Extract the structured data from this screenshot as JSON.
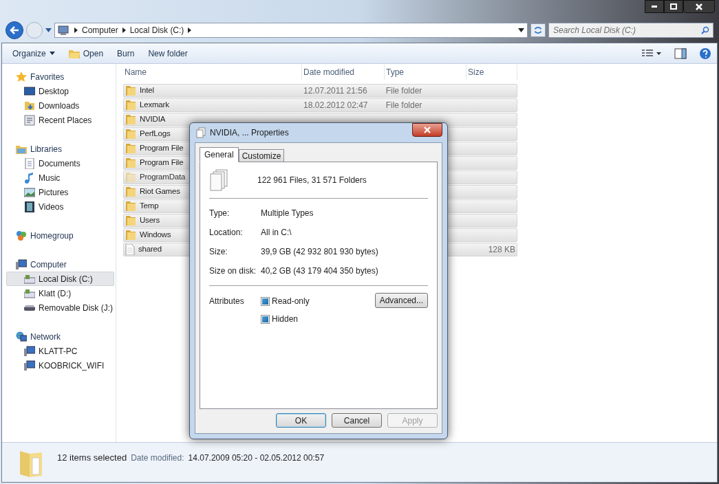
{
  "address_bar": {
    "crumbs": [
      "Computer",
      "Local Disk (C:)"
    ],
    "search_placeholder": "Search Local Disk (C:)"
  },
  "toolbar": {
    "items": [
      {
        "label": "Organize",
        "kind": "menu"
      },
      {
        "label": "Open",
        "kind": "icon"
      },
      {
        "label": "Burn",
        "kind": "plain"
      },
      {
        "label": "New folder",
        "kind": "plain"
      }
    ]
  },
  "sidebar": {
    "groups": [
      {
        "label": "Favorites",
        "kind": "star",
        "items": [
          {
            "label": "Desktop",
            "kind": "desktop",
            "selected": false
          },
          {
            "label": "Downloads",
            "kind": "download",
            "selected": false
          },
          {
            "label": "Recent Places",
            "kind": "recent",
            "selected": false
          }
        ]
      },
      {
        "label": "Libraries",
        "kind": "library",
        "items": [
          {
            "label": "Documents",
            "kind": "document",
            "selected": false
          },
          {
            "label": "Music",
            "kind": "music",
            "selected": false
          },
          {
            "label": "Pictures",
            "kind": "picture",
            "selected": false
          },
          {
            "label": "Videos",
            "kind": "video",
            "selected": false
          }
        ]
      },
      {
        "label": "Homegroup",
        "kind": "homegroup"
      },
      {
        "label": "Computer",
        "kind": "computer",
        "items": [
          {
            "label": "Local Disk (C:)",
            "kind": "disk",
            "selected": true
          },
          {
            "label": "Klatt (D:)",
            "kind": "disk",
            "selected": false
          },
          {
            "label": "Removable Disk (J:)",
            "kind": "removable",
            "selected": false
          }
        ]
      },
      {
        "label": "Network",
        "kind": "network",
        "items": [
          {
            "label": "KLATT-PC",
            "kind": "computer",
            "selected": false
          },
          {
            "label": "KOOBRICK_WIFI",
            "kind": "computer",
            "selected": false
          }
        ]
      }
    ]
  },
  "file_list": {
    "columns": [
      "Name",
      "Date modified",
      "Type",
      "Size"
    ],
    "rows": [
      {
        "name": "Intel",
        "date": "12.07.2011 21:56",
        "type": "File folder",
        "size": "",
        "kind": "folder",
        "hidden": false,
        "selected": true
      },
      {
        "name": "Lexmark",
        "date": "18.02.2012 02:47",
        "type": "File folder",
        "size": "",
        "kind": "folder",
        "hidden": false,
        "selected": true
      },
      {
        "name": "NVIDIA",
        "date": "",
        "type": "",
        "size": "",
        "kind": "folder",
        "hidden": false,
        "selected": true
      },
      {
        "name": "PerfLogs",
        "date": "",
        "type": "",
        "size": "",
        "kind": "folder",
        "hidden": false,
        "selected": true
      },
      {
        "name": "Program File",
        "date": "",
        "type": "",
        "size": "",
        "kind": "folder",
        "hidden": false,
        "selected": true
      },
      {
        "name": "Program File",
        "date": "",
        "type": "",
        "size": "",
        "kind": "folder",
        "hidden": false,
        "selected": true
      },
      {
        "name": "ProgramData",
        "date": "",
        "type": "",
        "size": "",
        "kind": "folder",
        "hidden": true,
        "selected": true
      },
      {
        "name": "Riot Games",
        "date": "",
        "type": "",
        "size": "",
        "kind": "folder",
        "hidden": false,
        "selected": true
      },
      {
        "name": "Temp",
        "date": "",
        "type": "",
        "size": "",
        "kind": "folder",
        "hidden": false,
        "selected": true
      },
      {
        "name": "Users",
        "date": "",
        "type": "",
        "size": "",
        "kind": "folder",
        "hidden": false,
        "selected": true
      },
      {
        "name": "Windows",
        "date": "",
        "type": "",
        "size": "",
        "kind": "folder",
        "hidden": false,
        "selected": true
      },
      {
        "name": "shared",
        "date": "",
        "type": "",
        "size": "128 KB",
        "kind": "file",
        "hidden": false,
        "selected": true
      }
    ]
  },
  "dialog": {
    "title": "NVIDIA, ... Properties",
    "tabs": [
      {
        "label": "General",
        "selected": true
      },
      {
        "label": "Customize",
        "selected": false
      }
    ],
    "summary": "122 961 Files, 31 571 Folders",
    "fields": [
      {
        "label": "Type:",
        "value": "Multiple Types"
      },
      {
        "label": "Location:",
        "value": "All in C:\\"
      },
      {
        "label": "Size:",
        "value": "39,9 GB (42 932 801 930 bytes)"
      },
      {
        "label": "Size on disk:",
        "value": "40,2 GB (43 179 404 350 bytes)"
      }
    ],
    "attributes_label": "Attributes",
    "attributes": [
      {
        "label": "Read-only",
        "indeterminate": true
      },
      {
        "label": "Hidden",
        "indeterminate": true
      }
    ],
    "advanced_button": "Advanced...",
    "buttons": [
      {
        "label": "OK",
        "default": true,
        "disabled": false
      },
      {
        "label": "Cancel",
        "default": false,
        "disabled": false
      },
      {
        "label": "Apply",
        "default": false,
        "disabled": true
      }
    ]
  },
  "status_bar": {
    "count": "12 items selected",
    "date_label": "Date modified:",
    "date_range": "14.07.2009 05:20 - 02.05.2012 00:57"
  }
}
